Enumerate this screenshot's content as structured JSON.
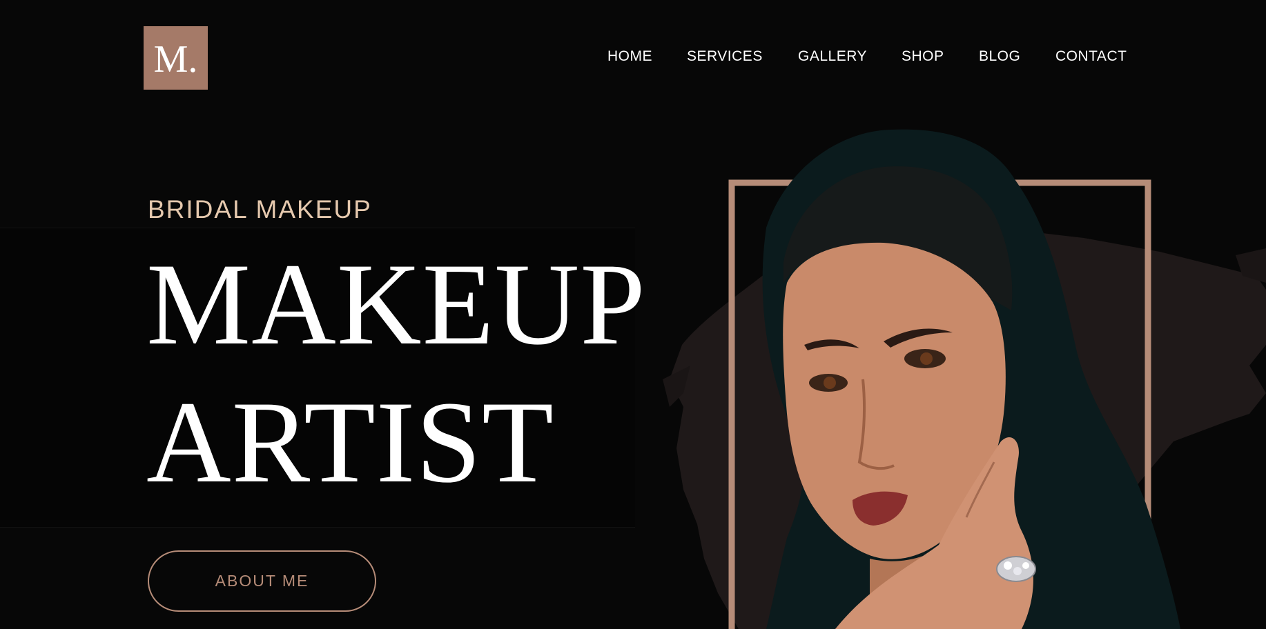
{
  "logo": {
    "text": "M."
  },
  "nav": {
    "items": [
      {
        "label": "HOME"
      },
      {
        "label": "SERVICES"
      },
      {
        "label": "GALLERY"
      },
      {
        "label": "SHOP"
      },
      {
        "label": "BLOG"
      },
      {
        "label": "CONTACT"
      }
    ]
  },
  "hero": {
    "subtitle": "BRIDAL MAKEUP",
    "title_line1": "MAKEUP",
    "title_line2": "ARTIST",
    "cta_label": "ABOUT ME"
  },
  "colors": {
    "background": "#070707",
    "accent": "#a57a68",
    "subtitle": "#e6c9ae",
    "button_outline": "#b68c78",
    "frame": "#b68c78",
    "brush_stroke": "#1f1919",
    "hijab": "#0b1b1d",
    "skin": "#c98a6a"
  },
  "icons": {
    "portrait": "woman-portrait-image"
  }
}
